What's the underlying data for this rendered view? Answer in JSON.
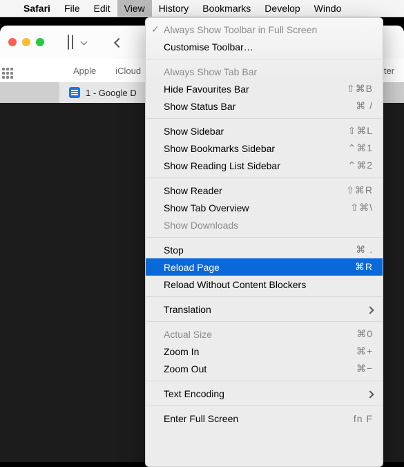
{
  "menubar": {
    "apple": "",
    "app": "Safari",
    "items": [
      "File",
      "Edit",
      "View",
      "History",
      "Bookmarks",
      "Develop",
      "Windo"
    ],
    "open_index": 2
  },
  "window": {
    "favorites_partial_right": "ter",
    "favorites": [
      "Apple",
      "iCloud"
    ],
    "tab": {
      "title": "1 - Google D"
    }
  },
  "menu": {
    "groups": [
      [
        {
          "label": "Always Show Toolbar in Full Screen",
          "disabled": true,
          "checked": true
        },
        {
          "label": "Customise Toolbar…"
        }
      ],
      [
        {
          "label": "Always Show Tab Bar",
          "disabled": true
        },
        {
          "label": "Hide Favourites Bar",
          "shortcut": "⇧⌘B"
        },
        {
          "label": "Show Status Bar",
          "shortcut": "⌘ /"
        }
      ],
      [
        {
          "label": "Show Sidebar",
          "shortcut": "⇧⌘L"
        },
        {
          "label": "Show Bookmarks Sidebar",
          "shortcut": "⌃⌘1"
        },
        {
          "label": "Show Reading List Sidebar",
          "shortcut": "⌃⌘2"
        }
      ],
      [
        {
          "label": "Show Reader",
          "shortcut": "⇧⌘R"
        },
        {
          "label": "Show Tab Overview",
          "shortcut": "⇧⌘\\"
        },
        {
          "label": "Show Downloads",
          "disabled": true
        }
      ],
      [
        {
          "label": "Stop",
          "shortcut": "⌘ ."
        },
        {
          "label": "Reload Page",
          "shortcut": "⌘R",
          "selected": true
        },
        {
          "label": "Reload Without Content Blockers"
        }
      ],
      [
        {
          "label": "Translation",
          "submenu": true
        }
      ],
      [
        {
          "label": "Actual Size",
          "shortcut": "⌘0",
          "disabled": true
        },
        {
          "label": "Zoom In",
          "shortcut": "⌘+"
        },
        {
          "label": "Zoom Out",
          "shortcut": "⌘−"
        }
      ],
      [
        {
          "label": "Text Encoding",
          "submenu": true
        }
      ],
      [
        {
          "label": "Enter Full Screen",
          "shortcut": "fn F"
        }
      ]
    ]
  }
}
